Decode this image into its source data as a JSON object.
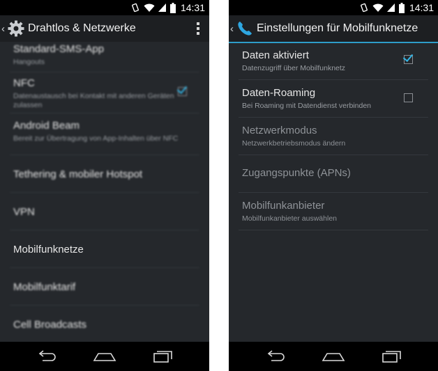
{
  "status_bar": {
    "time": "14:31"
  },
  "left_screen": {
    "action_bar": {
      "title": "Drahtlos & Netzwerke"
    },
    "items": [
      {
        "title": "Standard-SMS-App",
        "subtitle": "Hangouts"
      },
      {
        "title": "NFC",
        "subtitle": "Datenaustausch bei Kontakt mit anderen Geräten zulassen",
        "checked": true
      },
      {
        "title": "Android Beam",
        "subtitle": "Bereit zur Übertragung von App-Inhalten über NFC"
      },
      {
        "title": "Tethering & mobiler Hotspot"
      },
      {
        "title": "VPN"
      },
      {
        "title": "Mobilfunknetze"
      },
      {
        "title": "Mobilfunktarif"
      },
      {
        "title": "Cell Broadcasts"
      }
    ]
  },
  "right_screen": {
    "action_bar": {
      "title": "Einstellungen für Mobilfunknetze"
    },
    "items": [
      {
        "title": "Daten aktiviert",
        "subtitle": "Datenzugriff über Mobilfunknetz",
        "checked": true
      },
      {
        "title": "Daten-Roaming",
        "subtitle": "Bei Roaming mit Datendienst verbinden",
        "checked": false
      },
      {
        "title": "Netzwerkmodus",
        "subtitle": "Netzwerkbetriebsmodus ändern"
      },
      {
        "title": "Zugangspunkte (APNs)"
      },
      {
        "title": "Mobilfunkanbieter",
        "subtitle": "Mobilfunkanbieter auswählen"
      }
    ]
  },
  "colors": {
    "accent": "#33b5e5",
    "background": "#25282c",
    "action_bar": "#1d1f22"
  },
  "icons": [
    "back-arrow-icon",
    "settings-gear-icon",
    "overflow-menu-icon",
    "phone-icon",
    "vibrate-icon",
    "wifi-icon",
    "signal-icon",
    "battery-icon",
    "nav-back-icon",
    "nav-home-icon",
    "nav-recents-icon"
  ]
}
